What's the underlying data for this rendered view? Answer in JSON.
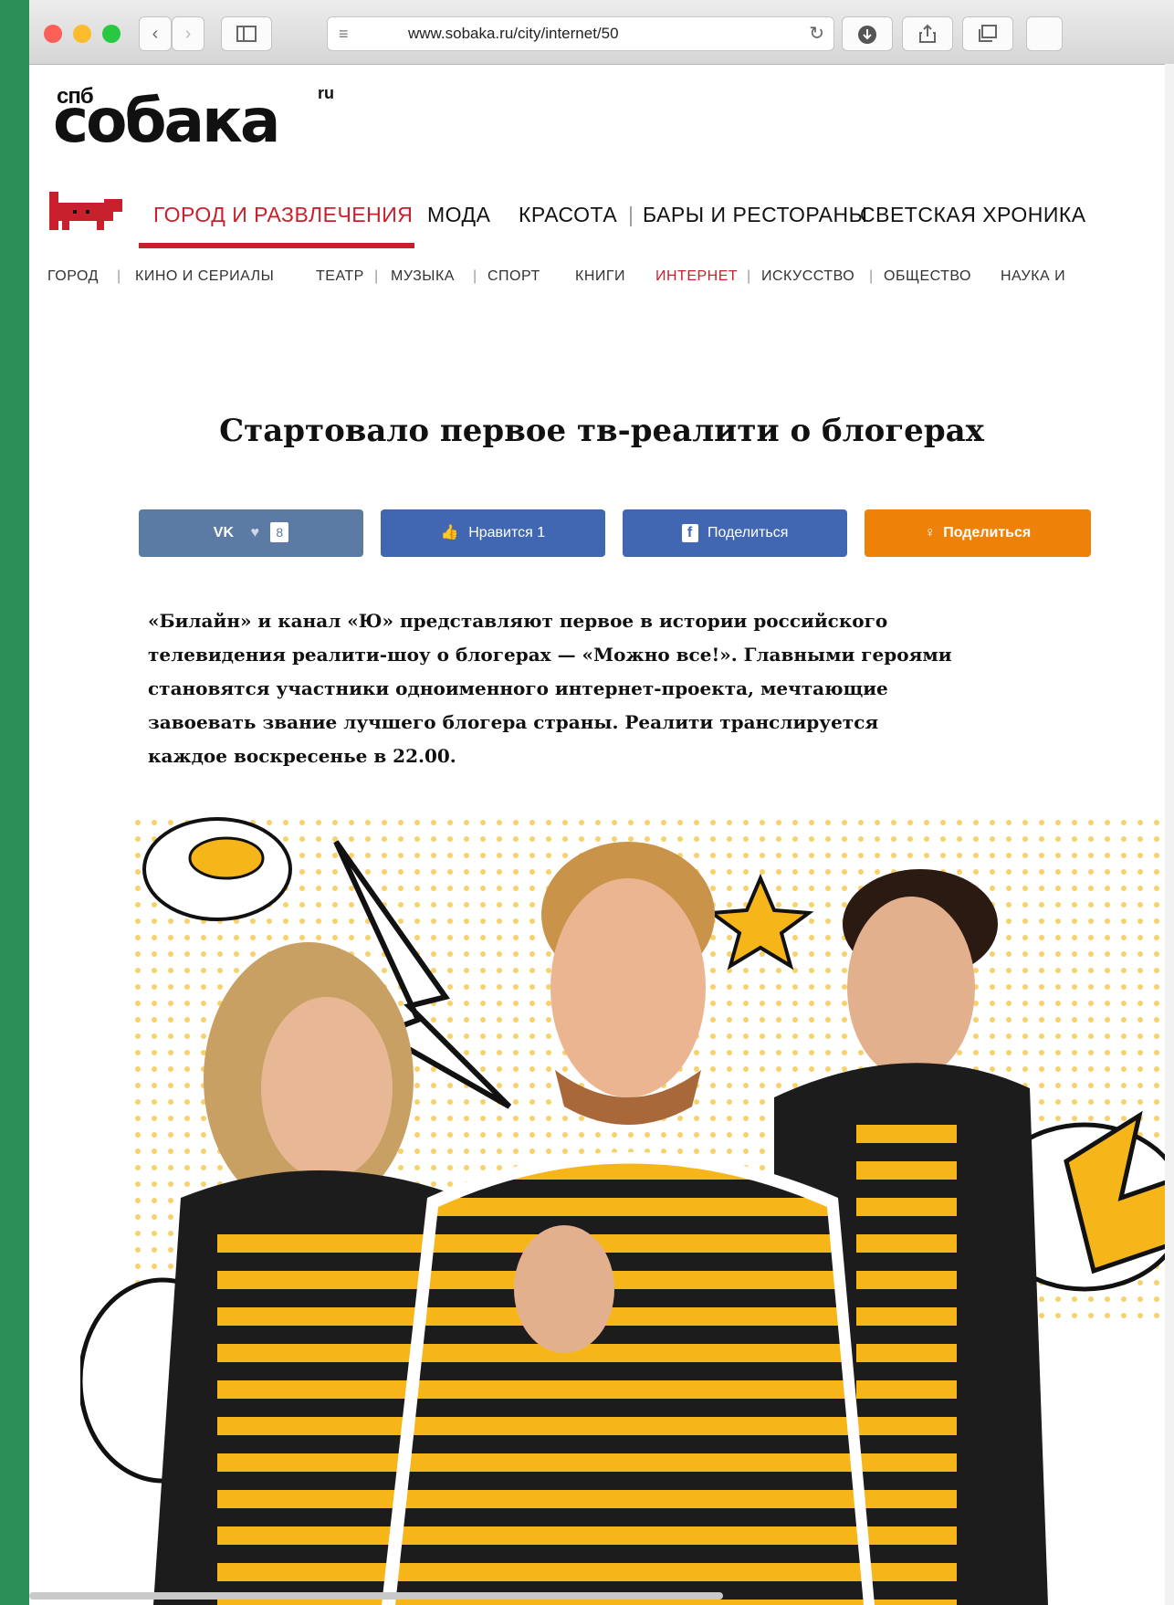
{
  "browser": {
    "url": "www.sobaka.ru/city/internet/50",
    "icons": {
      "back": "chevron-left-icon",
      "forward": "chevron-right-icon",
      "sidebar": "sidebar-icon",
      "reader": "reader-icon",
      "reload": "reload-icon",
      "download": "download-icon",
      "share": "share-icon",
      "tabs": "tabs-icon"
    }
  },
  "site": {
    "logo_prefix": "спб",
    "logo": "собака",
    "logo_suffix": "ru",
    "brand_color": "#c8202c"
  },
  "nav": {
    "main": [
      "ГОРОД И РАЗВЛЕЧЕНИЯ",
      "МОДА",
      "КРАСОТА",
      "БАРЫ И РЕСТОРАНЫ",
      "СВЕТСКАЯ ХРОНИКА"
    ],
    "main_separator": "|",
    "sub": [
      "ГОРОД",
      "КИНО И СЕРИАЛЫ",
      "ТЕАТР",
      "МУЗЫКА",
      "СПОРТ",
      "КНИГИ",
      "ИНТЕРНЕТ",
      "ИСКУССТВО",
      "ОБЩЕСТВО",
      "НАУКА И"
    ],
    "sub_separator": "|"
  },
  "article": {
    "title": "Стартовало первое тв-реалити о блогерах",
    "share": {
      "vk_label": "VK",
      "vk_count": "8",
      "like_label": "Нравится 1",
      "fb_label": "Поделиться",
      "ok_label": "Поделиться"
    },
    "lead_lines": [
      "«Билайн» и канал «Ю» представляют первое в истории российского",
      "телевидения реалити-шоу о блогерах — «Можно все!». Главными героями",
      "становятся участники одноименного интернет-проекта, мечтающие",
      "завоевать звание лучшего блогера страны. Реалити транслируется",
      "каждое воскресенье в 22.00."
    ]
  },
  "colors": {
    "vk": "#5b7aa4",
    "fb": "#4267b2",
    "ok": "#ee8208",
    "stripe_yellow": "#f6b61a"
  }
}
